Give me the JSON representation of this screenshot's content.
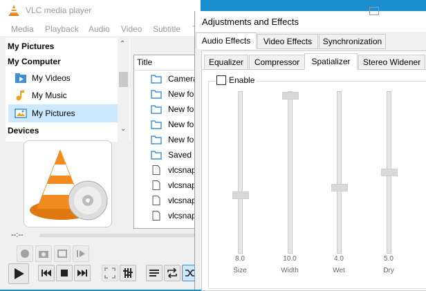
{
  "vlc": {
    "title": "VLC media player",
    "menus": [
      "Media",
      "Playback",
      "Audio",
      "Video",
      "Subtitle",
      "T"
    ],
    "sidebar": {
      "my_pictures_header": "My Pictures",
      "my_computer_header": "My Computer",
      "items": [
        {
          "label": "My Videos",
          "icon": "videos-folder-icon"
        },
        {
          "label": "My Music",
          "icon": "music-folder-icon"
        },
        {
          "label": "My Pictures",
          "icon": "pictures-folder-icon",
          "selected": true
        }
      ],
      "devices_header": "Devices"
    },
    "filelist": {
      "header": "Title",
      "rows": [
        {
          "label": "Camera",
          "type": "folder"
        },
        {
          "label": "New fold",
          "type": "folder"
        },
        {
          "label": "New fold",
          "type": "folder"
        },
        {
          "label": "New fold",
          "type": "folder"
        },
        {
          "label": "New fold",
          "type": "folder"
        },
        {
          "label": "Saved P",
          "type": "folder"
        },
        {
          "label": "vlcsnap-",
          "type": "file"
        },
        {
          "label": "vlcsnap-",
          "type": "file"
        },
        {
          "label": "vlcsnap-",
          "type": "file"
        },
        {
          "label": "vlcsnap-",
          "type": "file"
        }
      ]
    },
    "time": "--:--"
  },
  "dialog": {
    "title": "Adjustments and Effects",
    "tabs": [
      "Audio Effects",
      "Video Effects",
      "Synchronization"
    ],
    "subtabs": [
      "Equalizer",
      "Compressor",
      "Spatializer",
      "Stereo Widener"
    ],
    "enable_label": "Enable",
    "sliders": [
      {
        "name": "Size",
        "value": "8.0",
        "level": 0.35
      },
      {
        "name": "Width",
        "value": "10.0",
        "level": 1.0
      },
      {
        "name": "Wet",
        "value": "4.0",
        "level": 0.4
      },
      {
        "name": "Dry",
        "value": "5.0",
        "level": 0.5
      }
    ]
  },
  "colors": {
    "selection": "#cce8ff",
    "folder_blue": "#3d8fd6",
    "desktop_blue": "#1a8fd0",
    "cone_orange": "#f28c1e"
  }
}
